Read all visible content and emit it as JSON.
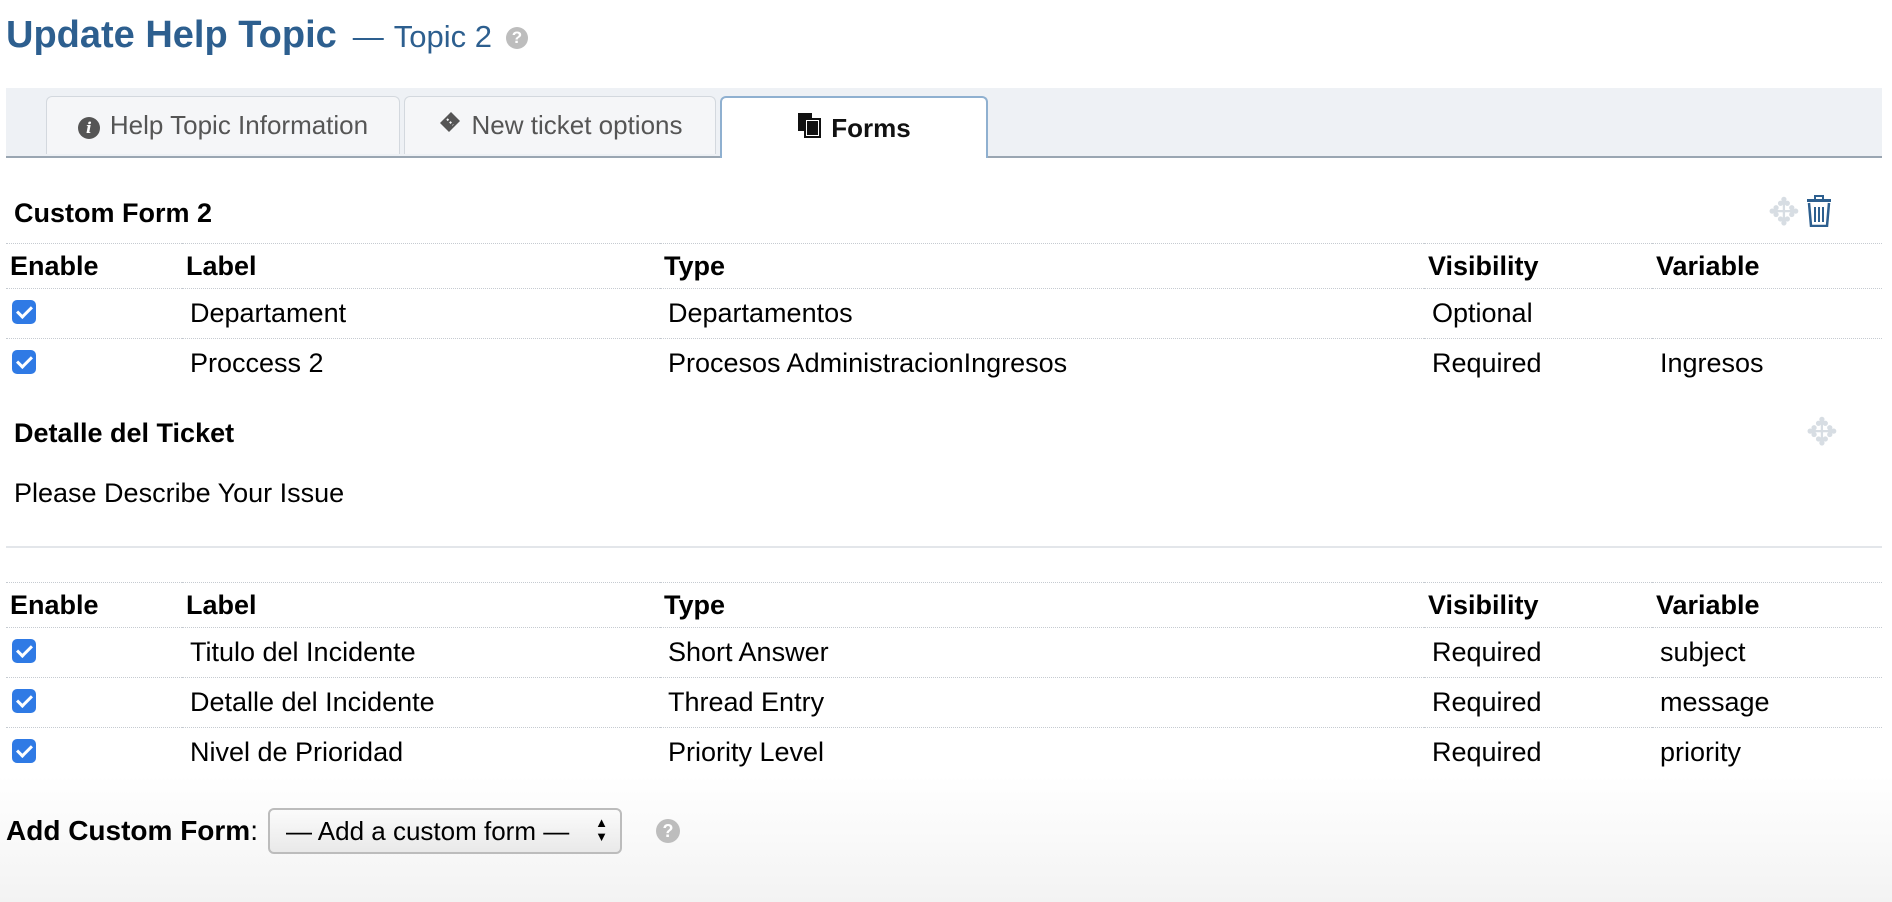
{
  "header": {
    "title": "Update Help Topic",
    "dash": "—",
    "topic": "Topic 2",
    "help_glyph": "?"
  },
  "tabs": [
    {
      "label": "Help Topic Information",
      "icon": "info-icon",
      "active": false
    },
    {
      "label": "New ticket options",
      "icon": "ticket-icon",
      "active": false
    },
    {
      "label": "Forms",
      "icon": "copy-icon",
      "active": true
    }
  ],
  "forms": [
    {
      "title": "Custom Form 2",
      "columns": {
        "enable": "Enable",
        "label": "Label",
        "type": "Type",
        "visibility": "Visibility",
        "variable": "Variable"
      },
      "rows": [
        {
          "enabled": true,
          "label": "Departament",
          "type": "Departamentos",
          "visibility": "Optional",
          "variable": ""
        },
        {
          "enabled": true,
          "label": "Proccess 2",
          "type": "Procesos AdministracionIngresos",
          "visibility": "Required",
          "variable": "Ingresos"
        }
      ]
    },
    {
      "title": "Detalle del Ticket",
      "description": "Please Describe Your Issue",
      "columns": {
        "enable": "Enable",
        "label": "Label",
        "type": "Type",
        "visibility": "Visibility",
        "variable": "Variable"
      },
      "rows": [
        {
          "enabled": true,
          "label": "Titulo del Incidente",
          "type": "Short Answer",
          "visibility": "Required",
          "variable": "subject"
        },
        {
          "enabled": true,
          "label": "Detalle del Incidente",
          "type": "Thread Entry",
          "visibility": "Required",
          "variable": "message"
        },
        {
          "enabled": true,
          "label": "Nivel de Prioridad",
          "type": "Priority Level",
          "visibility": "Required",
          "variable": "priority"
        }
      ]
    }
  ],
  "footer": {
    "add_label": "Add Custom Form",
    "colon": ":",
    "select_value": "— Add a custom form —",
    "help_glyph": "?"
  },
  "colors": {
    "title": "#2d5f8f",
    "checkbox": "#2f7ae5",
    "tab_bar": "#eef1f5"
  }
}
